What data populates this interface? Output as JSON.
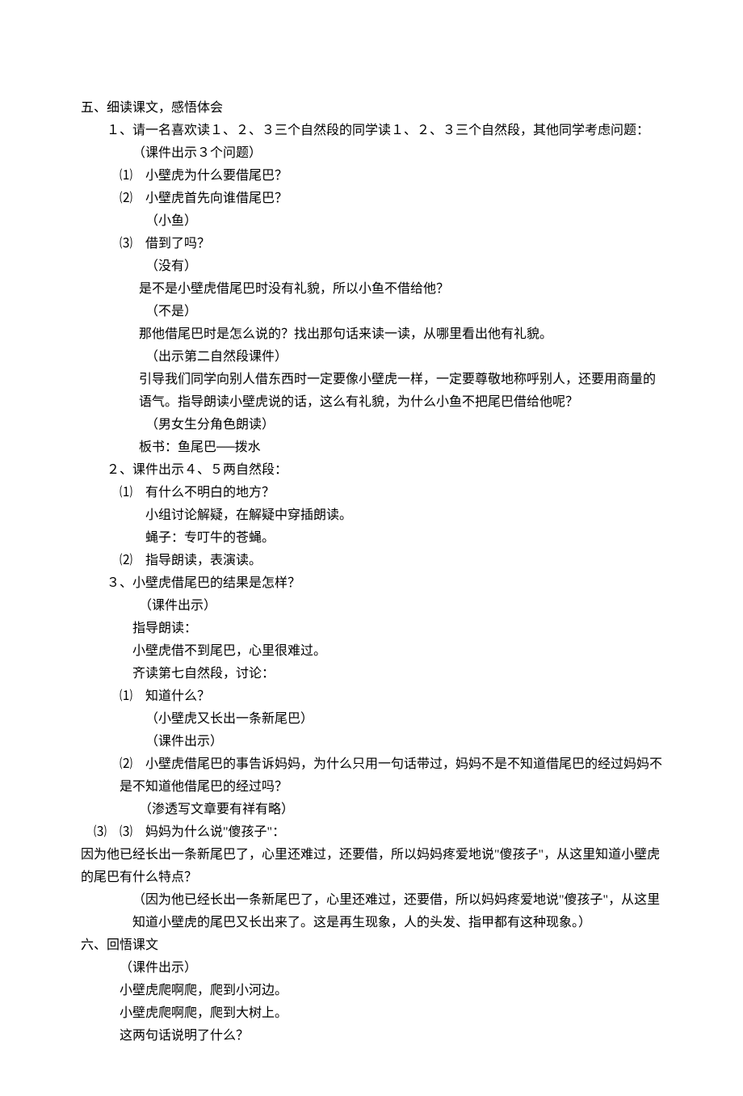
{
  "section5": {
    "heading": "五、细读课文，感悟体会",
    "p1": "１、请一名喜欢读１、２、３三个自然段的同学读１、２、３三个自然段，其他同学考虑问题：",
    "p1a": "（课件出示３个问题）",
    "q1": "⑴　小壁虎为什么要借尾巴？",
    "q2": "⑵　小壁虎首先向谁借尾巴？",
    "q2a": "（小鱼）",
    "q3": "⑶　借到了吗？",
    "q3a": "（没有）",
    "q3b": "是不是小壁虎借尾巴时没有礼貌，所以小鱼不借给他？",
    "q3c": "（不是）",
    "q3d": "那他借尾巴时是怎么说的？找出那句话来读一读，从哪里看出他有礼貌。",
    "q3e": "（出示第二自然段课件）",
    "q3f": "引导我们同学向别人借东西时一定要像小壁虎一样，一定要尊敬地称呼别人，还要用商量的语气。指导朗读小壁虎说的话，这么有礼貌，为什么小鱼不把尾巴借给他呢？",
    "q3g": "（男女生分角色朗读）",
    "q3h": "板书：鱼尾巴──拨水",
    "p2": "２、课件出示４、５两自然段：",
    "p2q1": "⑴　有什么不明白的地方？",
    "p2q1a": "小组讨论解疑，在解疑中穿插朗读。",
    "p2q1b": "蝇子：专叮牛的苍蝇。",
    "p2q2": "⑵　指导朗读，表演读。",
    "p3": "３、小壁虎借尾巴的结果是怎样？",
    "p3a": "（课件出示）",
    "p3b": "指导朗读：",
    "p3c": "小壁虎借不到尾巴，心里很难过。",
    "p3d": "齐读第七自然段，讨论：",
    "p3q1": "⑴　知道什么？",
    "p3q1a": "（小壁虎又长出一条新尾巴）",
    "p3q1b": "（课件出示）",
    "p3q2": "⑵　小壁虎借尾巴的事告诉妈妈，为什么只用一句话带过，妈妈不是不知道借尾巴的经过妈妈不是不知道他借尾巴的经过吗？",
    "p3q2a": "（渗透写文章要有祥有略）",
    "p3q3": "⑶　妈妈为什么说\"傻孩子\"：",
    "p3q3a": "因为他已经长出一条新尾巴了，心里还难过，还要借，所以妈妈疼爱地说\"傻孩子\"，从这里知道小壁虎的尾巴有什么特点？",
    "p3q3b": "（因为他已经长出一条新尾巴了，心里还难过，还要借，所以妈妈疼爱地说\"傻孩子\"，从这里知道小壁虎的尾巴又长出来了。这是再生现象，人的头发、指甲都有这种现象。）"
  },
  "section6": {
    "heading": "六、回悟课文",
    "a": "（课件出示）",
    "b": "小壁虎爬啊爬，爬到小河边。",
    "c": "小壁虎爬啊爬，爬到大树上。",
    "d": "这两句话说明了什么？"
  }
}
